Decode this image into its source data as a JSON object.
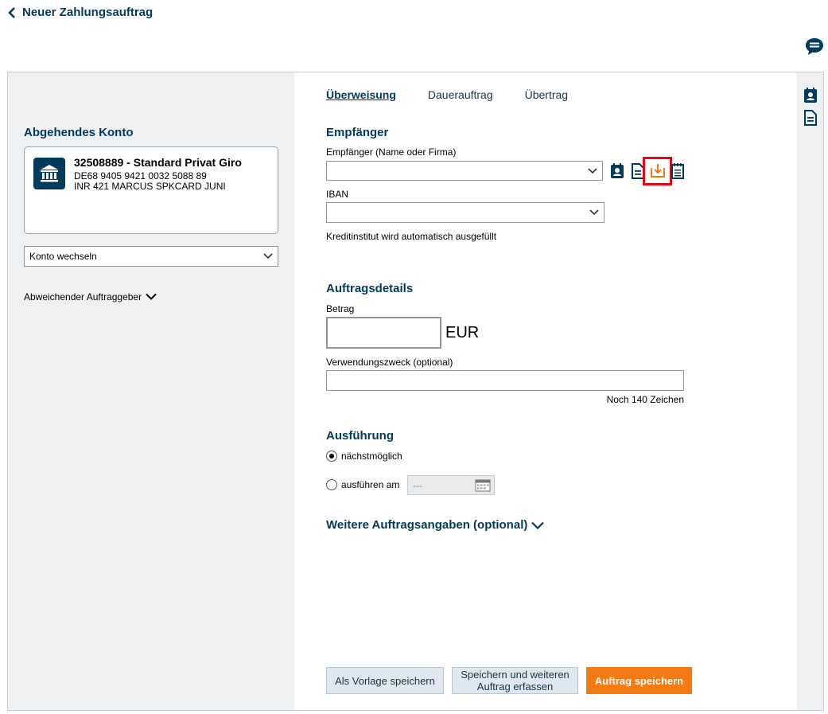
{
  "header": {
    "back_label": "Neuer Zahlungsauftrag"
  },
  "left": {
    "section_title": "Abgehendes Konto",
    "account": {
      "name": "32508889 - Standard Privat Giro",
      "iban": "DE68 9405 9421 0032 5088 89",
      "description": "INR 421 MARCUS SPKCARD JUNI"
    },
    "switch_account_label": "Konto wechseln",
    "other_originator_label": "Abweichender Auftraggeber"
  },
  "tabs": [
    {
      "label": "Überweisung",
      "active": true
    },
    {
      "label": "Dauerauftrag",
      "active": false
    },
    {
      "label": "Übertrag",
      "active": false
    }
  ],
  "recipient": {
    "section_title": "Empfänger",
    "name_label": "Empfänger (Name oder Firma)",
    "name_value": "",
    "iban_label": "IBAN",
    "iban_value": "",
    "bank_hint": "Kreditinstitut wird automatisch ausgefüllt"
  },
  "details": {
    "section_title": "Auftragsdetails",
    "amount_label": "Betrag",
    "amount_value": "",
    "currency": "EUR",
    "purpose_label": "Verwendungszweck (optional)",
    "purpose_value": "",
    "chars_left": "Noch 140 Zeichen"
  },
  "execution": {
    "section_title": "Ausführung",
    "option_next": "nächstmöglich",
    "option_date": "ausführen am",
    "date_value": "---",
    "selected": "next"
  },
  "more_details_label": "Weitere Auftragsangaben (optional)",
  "buttons": {
    "save_template": "Als Vorlage speichern",
    "save_and_new_line1": "Speichern und weiteren",
    "save_and_new_line2": "Auftrag erfassen",
    "save_order": "Auftrag speichern"
  },
  "colors": {
    "brand": "#003a5d",
    "accent": "#f47a14",
    "highlight": "#e30613"
  }
}
